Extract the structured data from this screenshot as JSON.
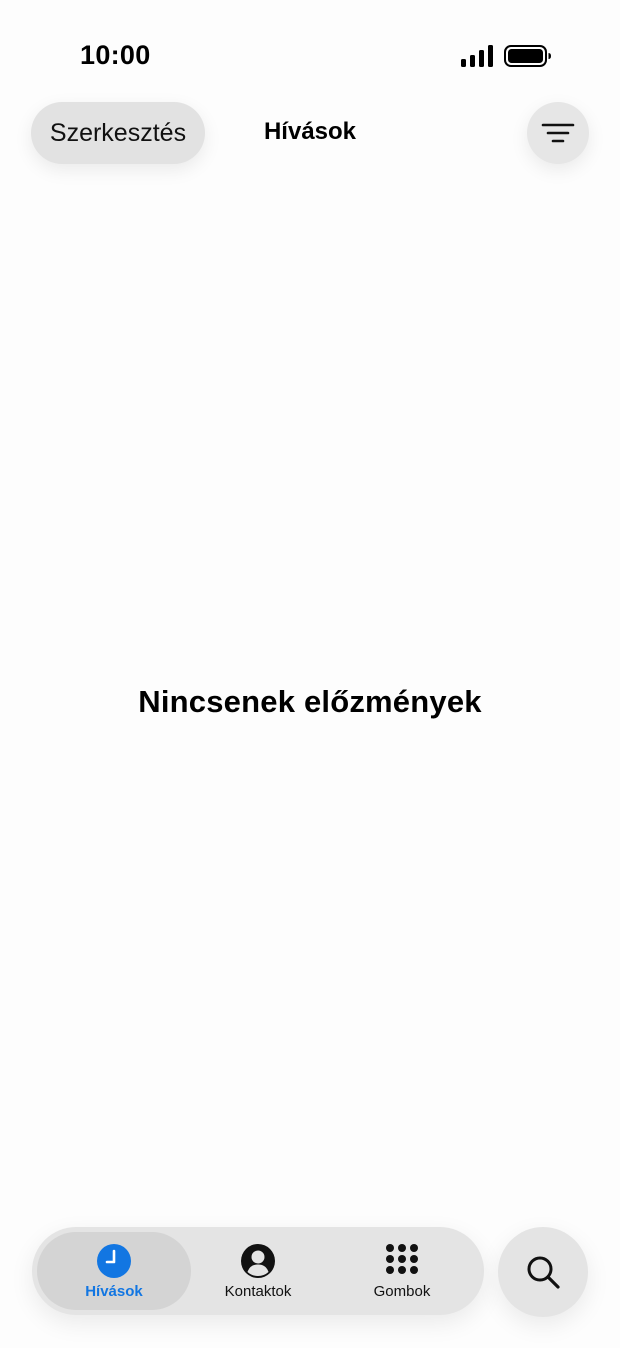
{
  "status_bar": {
    "time": "10:00"
  },
  "nav": {
    "edit_label": "Szerkesztés",
    "title": "Hívások",
    "filter_icon": "filter-lines-icon"
  },
  "main": {
    "empty_message": "Nincsenek előzmények"
  },
  "tab_bar": {
    "tabs": [
      {
        "label": "Hívások",
        "icon": "clock-icon",
        "selected": true
      },
      {
        "label": "Kontaktok",
        "icon": "person-circle-icon",
        "selected": false
      },
      {
        "label": "Gombok",
        "icon": "keypad-icon",
        "selected": false
      }
    ],
    "search_icon": "search-icon"
  },
  "colors": {
    "accent": "#1276e2",
    "background": "#fdfdfd",
    "button_background": "#e2e2e2",
    "selected_tab_background": "#d4d4d4"
  }
}
